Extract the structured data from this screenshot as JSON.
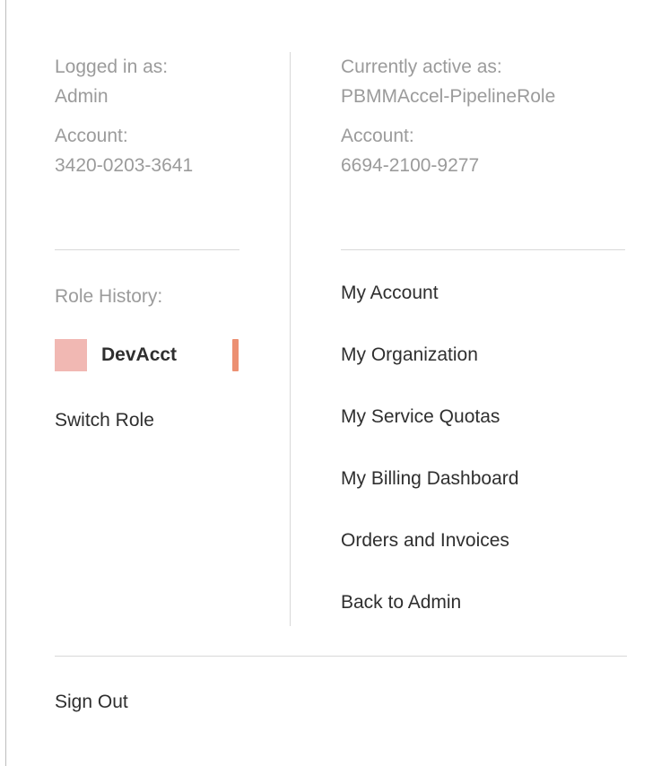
{
  "session": {
    "logged_in_label": "Logged in as:",
    "logged_in_value": "Admin",
    "account_label": "Account:",
    "account_value": "3420-0203-3641"
  },
  "active": {
    "active_label": "Currently active as:",
    "active_value": "PBMMAccel-PipelineRole",
    "account_label": "Account:",
    "account_value": "6694-2100-9277"
  },
  "role_history": {
    "label": "Role History:",
    "items": [
      {
        "name": "DevAcct",
        "swatch_color": "#f1b8b3",
        "bar_color": "#ec9072"
      }
    ],
    "switch_role_label": "Switch Role"
  },
  "menu": {
    "items": [
      {
        "label": "My Account"
      },
      {
        "label": "My Organization"
      },
      {
        "label": "My Service Quotas"
      },
      {
        "label": "My Billing Dashboard"
      },
      {
        "label": "Orders and Invoices"
      },
      {
        "label": "Back to Admin"
      }
    ]
  },
  "footer": {
    "sign_out_label": "Sign Out"
  }
}
